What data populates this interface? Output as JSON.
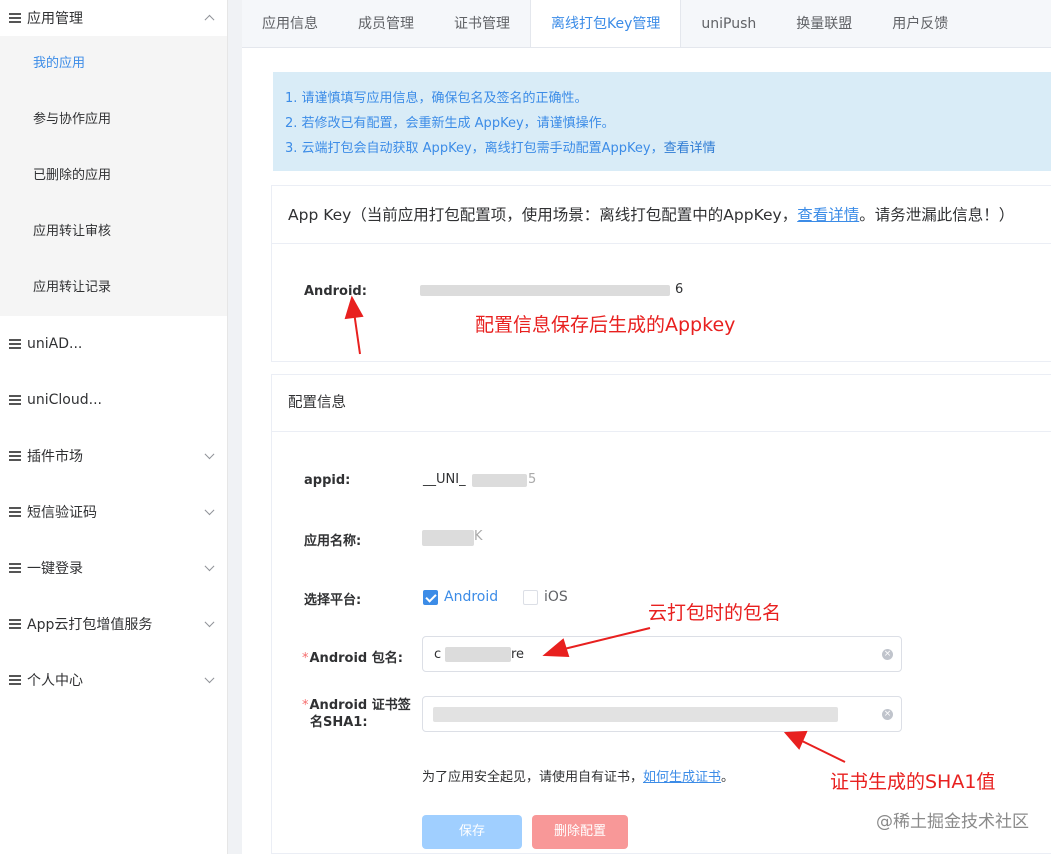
{
  "sidebar": {
    "groups": [
      {
        "label": "应用管理",
        "expanded": true
      },
      {
        "label": "uniAD..."
      },
      {
        "label": "uniCloud..."
      },
      {
        "label": "插件市场"
      },
      {
        "label": "短信验证码"
      },
      {
        "label": "一键登录"
      },
      {
        "label": "App云打包增值服务"
      },
      {
        "label": "个人中心"
      }
    ],
    "sub_items": [
      "我的应用",
      "参与协作应用",
      "已删除的应用",
      "应用转让审核",
      "应用转让记录"
    ]
  },
  "tabs": [
    "应用信息",
    "成员管理",
    "证书管理",
    "离线打包Key管理",
    "uniPush",
    "换量联盟",
    "用户反馈"
  ],
  "notice": {
    "line1": "1. 请谨慎填写应用信息，确保包名及签名的正确性。",
    "line2": "2. 若修改已有配置，会重新生成 AppKey，请谨慎操作。",
    "line3": "3. 云端打包会自动获取 AppKey，离线打包需手动配置AppKey，",
    "line3_link": "查看详情"
  },
  "appkey_card": {
    "header_prefix": "App Key（当前应用打包配置项，使用场景：离线打包配置中的AppKey，",
    "header_link": "查看详情",
    "header_suffix": "。请务泄漏此信息！）",
    "android_label": "Android:",
    "android_value_tail": "6"
  },
  "config_card": {
    "header": "配置信息",
    "appid_label": "appid:",
    "appid_value": "__UNI_",
    "appid_tail": "5",
    "app_name_label": "应用名称:",
    "app_name_tail": "K",
    "platform_label": "选择平台:",
    "platform_android": "Android",
    "platform_ios": "iOS",
    "required_mark": "*",
    "package_label": "Android 包名:",
    "package_value_head": "c",
    "package_value_tail": "re",
    "sha1_label_line1": "Android 证书签",
    "sha1_label_line2": "名SHA1:",
    "hint_text": "为了应用安全起见，请使用自有证书，",
    "hint_link": "如何生成证书",
    "hint_end": "。",
    "save_button": "保存",
    "delete_button": "删除配置"
  },
  "annotations": {
    "appkey": "配置信息保存后生成的Appkey",
    "package": "云打包时的包名",
    "sha1": "证书生成的SHA1值"
  },
  "watermark": "@稀土掘金技术社区",
  "colors": {
    "accent": "#3c8ce7",
    "annotation": "#e8201f",
    "notice_bg": "#d9ecf7",
    "delete": "#f89898"
  }
}
